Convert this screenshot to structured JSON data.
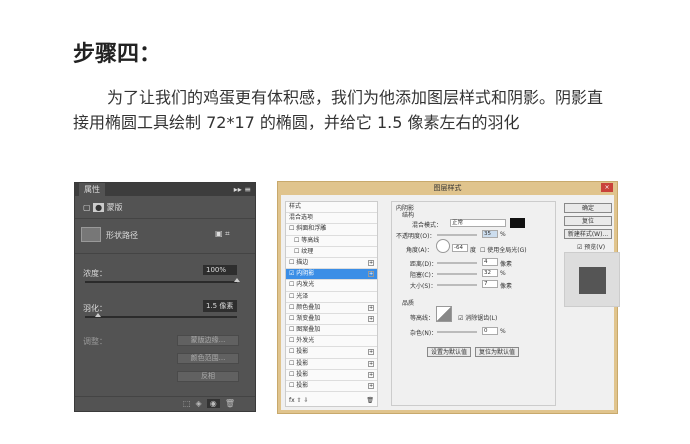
{
  "heading": "步骤四：",
  "paragraph": "为了让我们的鸡蛋更有体积感，我们为他添加图层样式和阴影。阴影直接用椭圆工具绘制 72*17 的椭圆，并给它 1.5 像素左右的羽化",
  "properties_panel": {
    "tab": "属性",
    "mask_label": "蒙版",
    "shape_label": "形状路径",
    "density_label": "浓度：",
    "density_value": "100%",
    "feather_label": "羽化：",
    "feather_value": "1.5 像素",
    "adjust_label": "调整：",
    "buttons": [
      "蒙版边缘...",
      "颜色范围...",
      "反相"
    ],
    "density_fraction": 1.0,
    "feather_fraction": 0.08
  },
  "layer_style": {
    "title": "图层样式",
    "close": "×",
    "list": [
      {
        "label": "样式"
      },
      {
        "label": "混合选项"
      },
      {
        "label": "斜面和浮雕",
        "cb": true
      },
      {
        "label": "等高线",
        "cb": true,
        "indent": true
      },
      {
        "label": "纹理",
        "cb": true,
        "indent": true
      },
      {
        "label": "描边",
        "cb": true,
        "plus": true
      },
      {
        "label": "内阴影",
        "cb": true,
        "checked": true,
        "plus": true,
        "selected": true
      },
      {
        "label": "内发光",
        "cb": true
      },
      {
        "label": "光泽",
        "cb": true
      },
      {
        "label": "颜色叠加",
        "cb": true,
        "plus": true
      },
      {
        "label": "渐变叠加",
        "cb": true,
        "plus": true
      },
      {
        "label": "图案叠加",
        "cb": true
      },
      {
        "label": "外发光",
        "cb": true
      },
      {
        "label": "投影",
        "cb": true,
        "plus": true
      },
      {
        "label": "投影",
        "cb": true,
        "plus": true
      },
      {
        "label": "投影",
        "cb": true,
        "plus": true
      },
      {
        "label": "投影",
        "cb": true,
        "plus": true
      }
    ],
    "section": "内阴影",
    "structure": "结构",
    "blend_label": "混合模式：",
    "blend_value": "正常",
    "opacity_label": "不透明度(O)：",
    "opacity_value": "35",
    "pct": "%",
    "angle_label": "角度(A)：",
    "angle_value": "-64",
    "deg": "度",
    "global_light": "使用全局光(G)",
    "distance_label": "距离(D)：",
    "distance_value": "4",
    "px": "像素",
    "choke_label": "阻塞(C)：",
    "choke_value": "32",
    "size_label": "大小(S)：",
    "size_value": "7",
    "quality": "品质",
    "contour_label": "等高线：",
    "antialias": "消除锯齿(L)",
    "noise_label": "杂色(N)：",
    "noise_value": "0",
    "set_default": "设置为默认值",
    "reset_default": "复位为默认值",
    "ok": "确定",
    "reset": "复位",
    "new_style": "新建样式(W)...",
    "preview": "预览(V)",
    "shadow_color": "#111111",
    "preview_color": "#555555"
  }
}
